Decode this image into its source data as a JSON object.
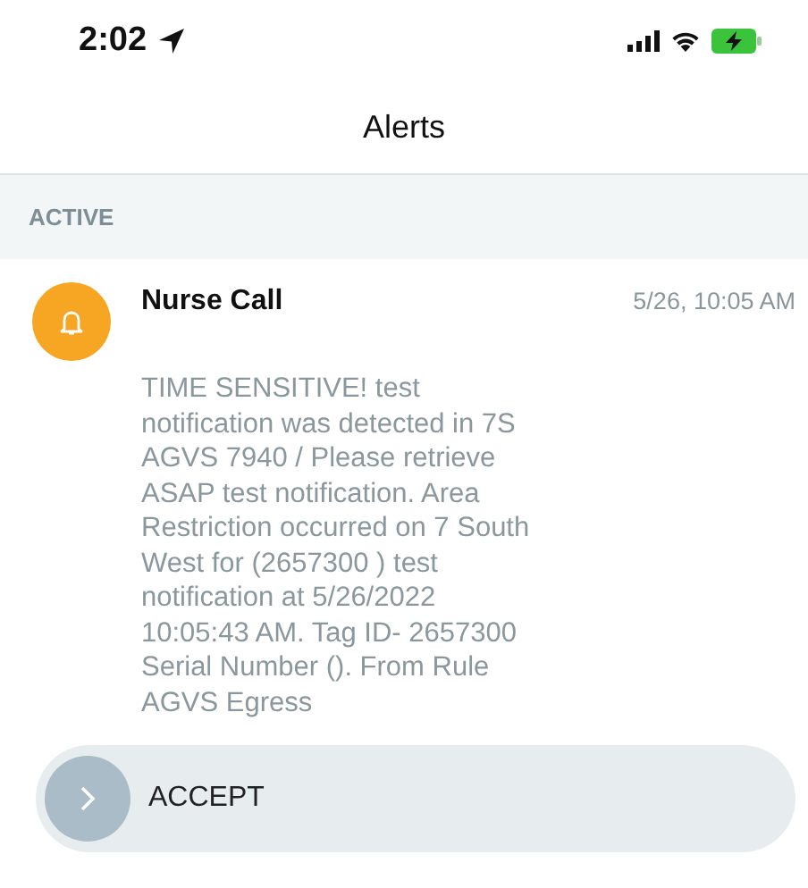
{
  "status_bar": {
    "time": "2:02"
  },
  "header": {
    "title": "Alerts"
  },
  "section": {
    "label": "ACTIVE"
  },
  "alerts": [
    {
      "kind": "bell",
      "title": "Nurse Call",
      "time": "5/26, 10:05 AM",
      "message_lines": [
        "TIME SENSITIVE! test",
        "notification was detected in 7S",
        "AGVS 7940 / Please retrieve",
        "ASAP test notification. Area",
        "Restriction occurred on 7 South",
        "West for (2657300 ) test",
        "notification at 5/26/2022",
        "10:05:43 AM. Tag ID- 2657300",
        "Serial Number (). From Rule",
        "AGVS Egress"
      ]
    }
  ],
  "accept": {
    "label": "ACCEPT",
    "level": 0
  }
}
